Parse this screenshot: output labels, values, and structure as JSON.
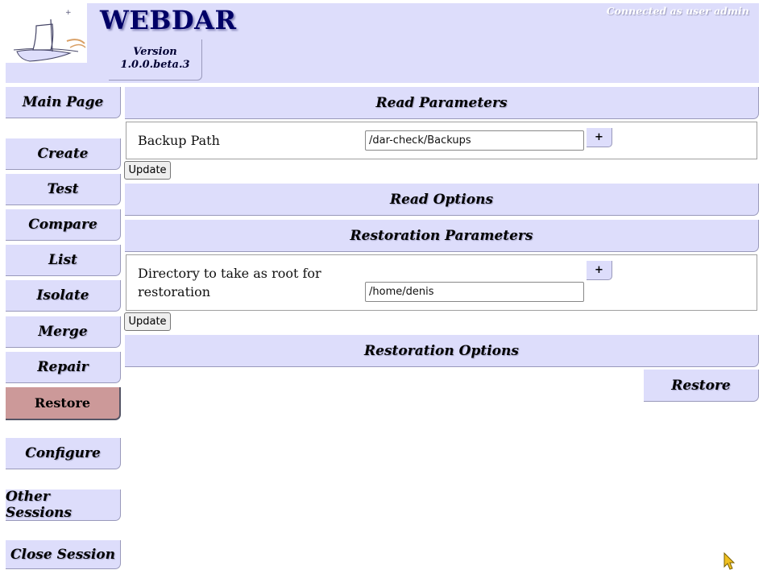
{
  "header": {
    "app_title": "WEBDAR",
    "connected_text": "Connected as user admin",
    "version_label": "Version",
    "version_number": "1.0.0.beta.3"
  },
  "sidebar": {
    "items": [
      {
        "label": "Main Page"
      },
      {
        "label": "Create"
      },
      {
        "label": "Test"
      },
      {
        "label": "Compare"
      },
      {
        "label": "List"
      },
      {
        "label": "Isolate"
      },
      {
        "label": "Merge"
      },
      {
        "label": "Repair"
      },
      {
        "label": "Restore",
        "active": true
      },
      {
        "label": "Configure"
      },
      {
        "label": "Other Sessions"
      },
      {
        "label": "Close Session"
      }
    ]
  },
  "main": {
    "read_parameters": {
      "title": "Read Parameters",
      "backup_path_label": "Backup Path",
      "backup_path_value": "/dar-check/Backups",
      "plus_label": "+",
      "update_label": "Update"
    },
    "read_options": {
      "title": "Read Options"
    },
    "restoration_parameters": {
      "title": "Restoration Parameters",
      "root_dir_label_line1": "Directory to take as root for",
      "root_dir_label_line2": "restoration",
      "root_dir_value": "/home/denis",
      "plus_label": "+",
      "update_label": "Update"
    },
    "restoration_options": {
      "title": "Restoration Options"
    },
    "restore_button_label": "Restore"
  },
  "colors": {
    "accent": "#ddddfb",
    "active_item": "#cc9999",
    "title": "#000066"
  }
}
